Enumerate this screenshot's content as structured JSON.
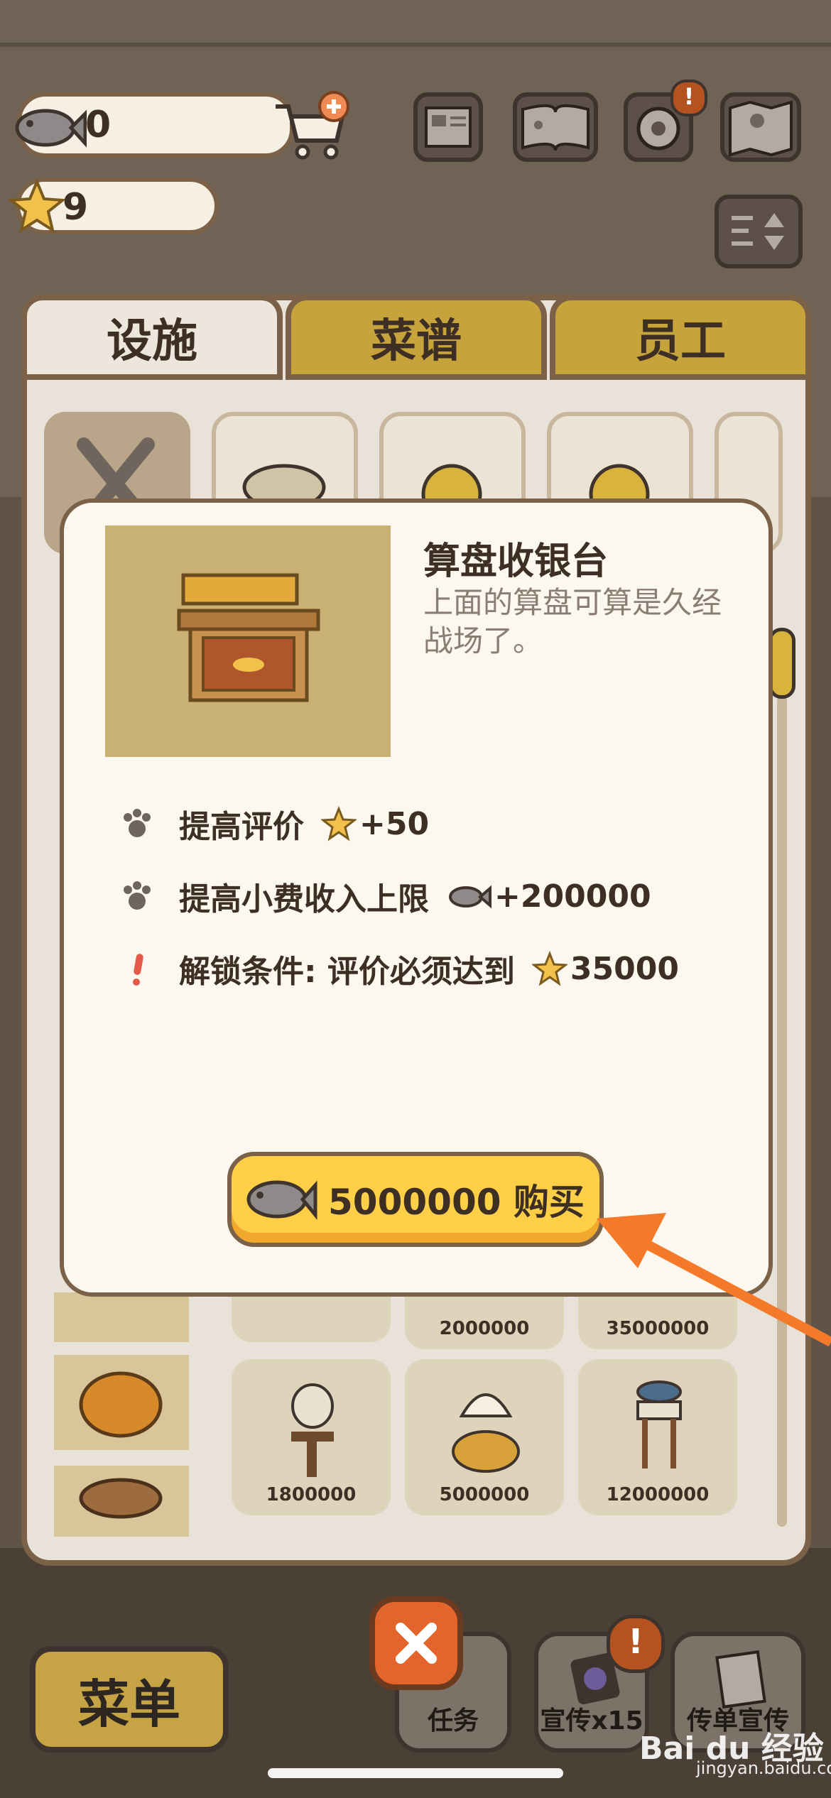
{
  "status": {
    "fish_count": "0",
    "star_count": "9"
  },
  "tabs": [
    {
      "label": "设施",
      "active": true
    },
    {
      "label": "菜谱",
      "active": false
    },
    {
      "label": "员工",
      "active": false
    }
  ],
  "popup": {
    "title": "算盘收银台",
    "description": "上面的算盘可算是久经战场了。",
    "rows": [
      {
        "icon": "paw-icon",
        "label": "提高评价",
        "value_icon": "star-icon",
        "value": "+50"
      },
      {
        "icon": "paw-icon",
        "label": "提高小费收入上限",
        "value_icon": "fish-icon",
        "value": "+200000"
      },
      {
        "icon": "exclamation-icon",
        "label": "解锁条件: 评价必须达到",
        "value_icon": "star-icon",
        "value": "35000"
      }
    ],
    "buy_label": "5000000 购买"
  },
  "items": [
    {
      "price": "2000000"
    },
    {
      "price": "35000000"
    },
    {
      "price": "1800000"
    },
    {
      "price": "5000000"
    },
    {
      "price": "12000000"
    }
  ],
  "bottom_nav": {
    "menu_label": "菜单",
    "tasks_label": "任务",
    "promo_label": "宣传x15",
    "flyer_label": "传单宣传"
  },
  "watermark": {
    "brand": "Bai du 经验",
    "url": "jingyan.baidu.com"
  },
  "colors": {
    "accent_yellow": "#ffcf47",
    "brown_border": "#7a6148",
    "close_orange": "#e2652b",
    "arrow_orange": "#f47a2a"
  }
}
